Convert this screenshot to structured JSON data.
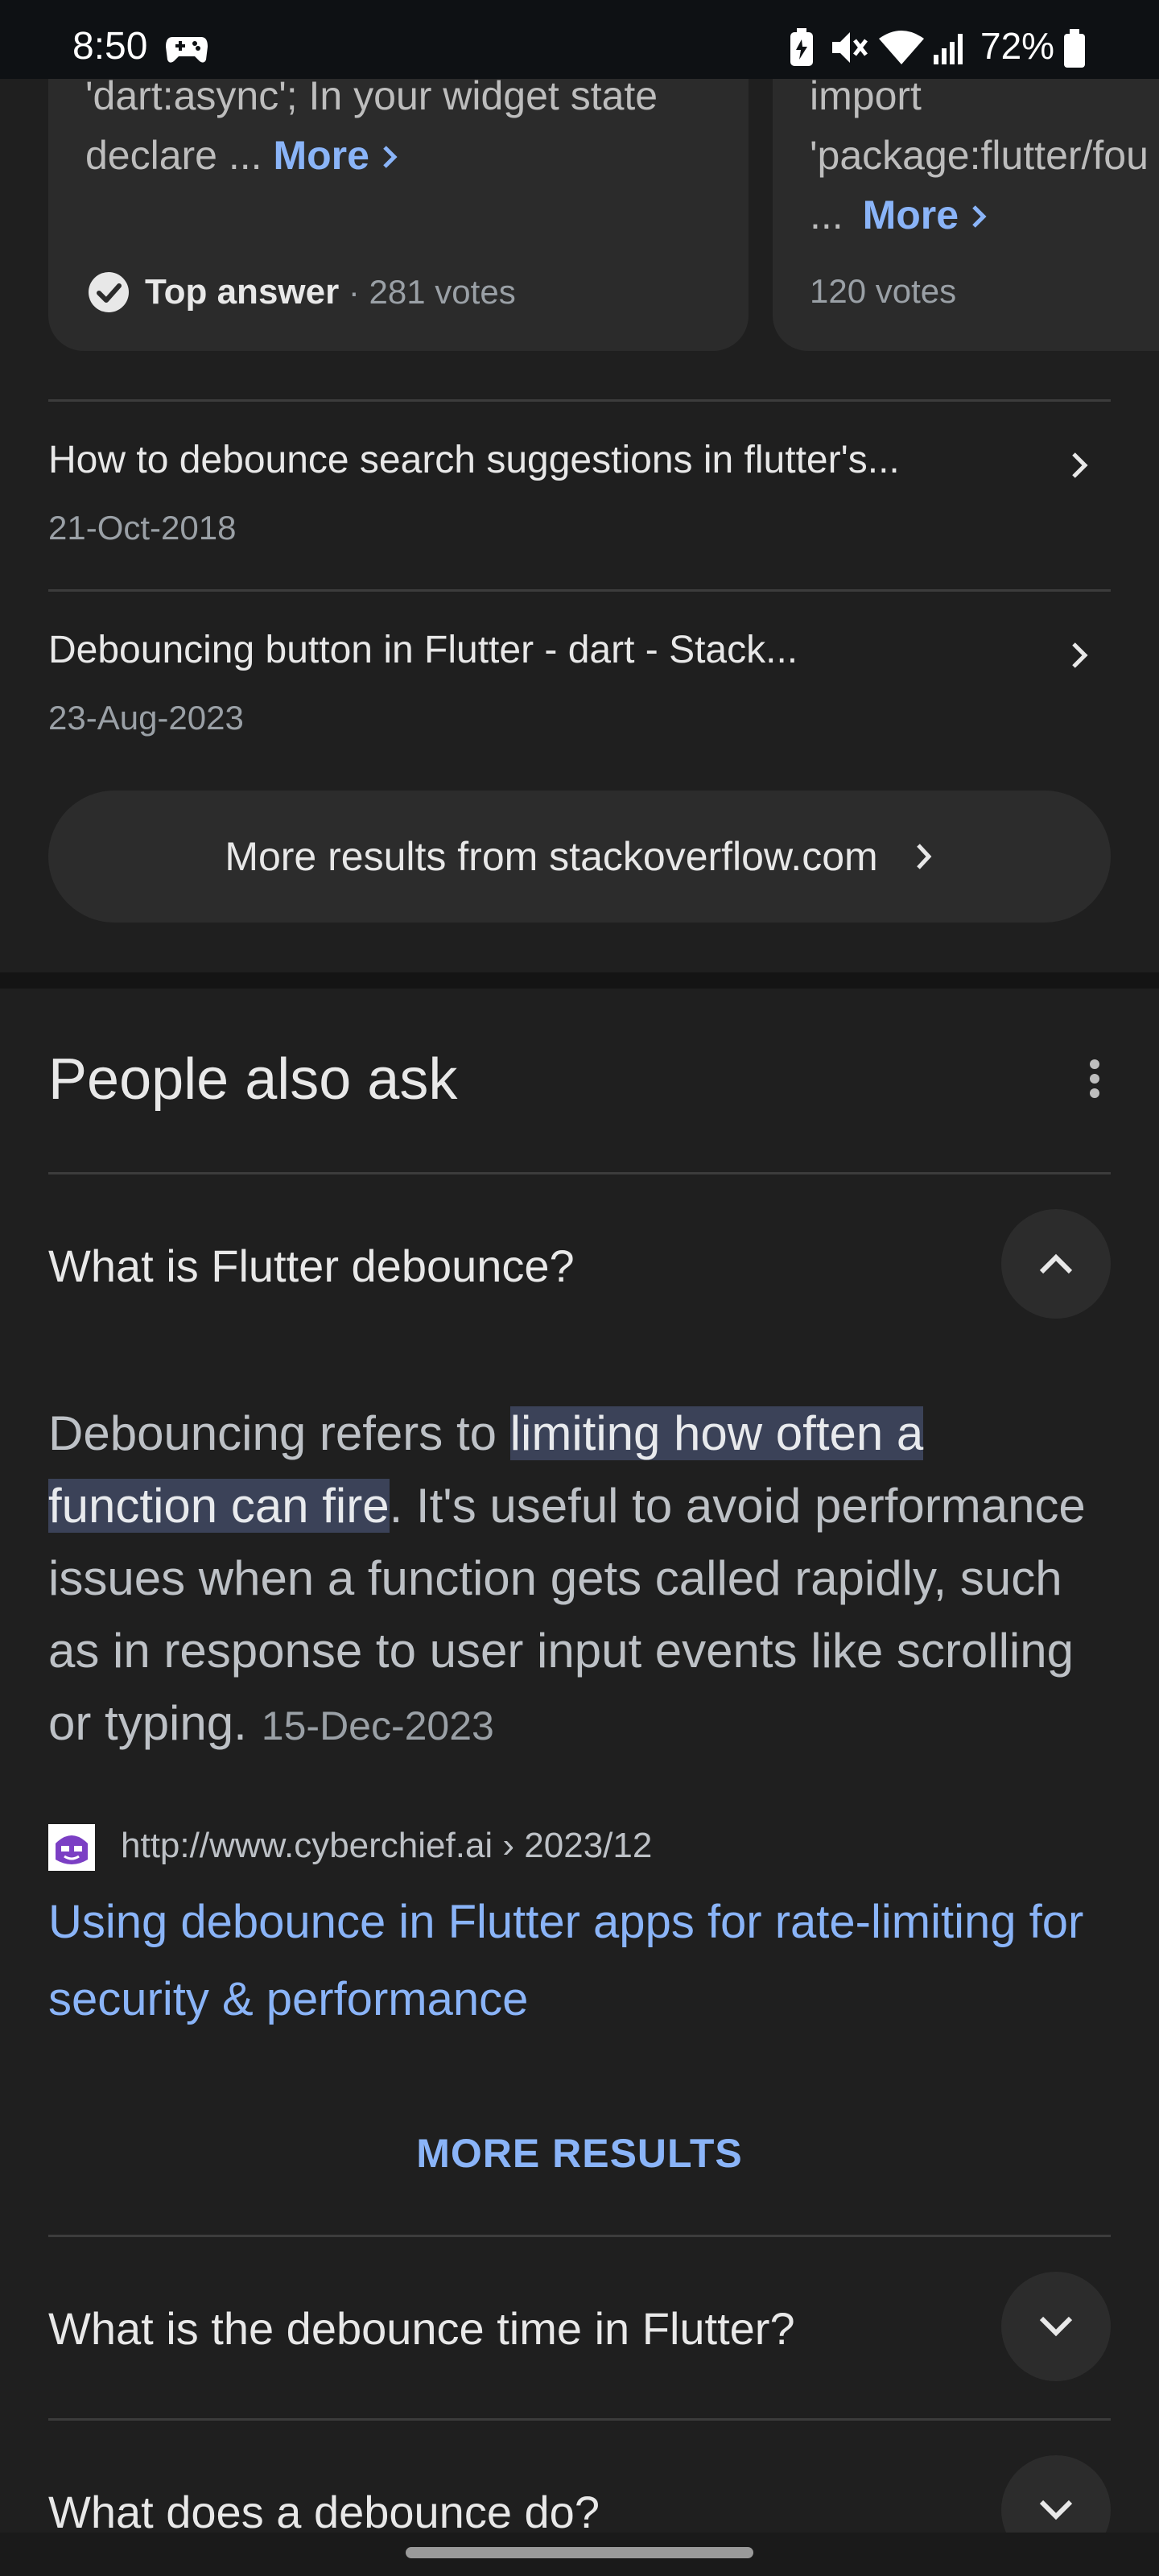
{
  "status_bar": {
    "time": "8:50",
    "battery": "72%",
    "icons": [
      "game-controller-icon",
      "battery-saver-icon",
      "mute-icon",
      "wifi-icon",
      "signal-icon",
      "battery-icon"
    ]
  },
  "cards": [
    {
      "line1": "'dart:async'; In your widget state",
      "line2": "declare ...",
      "more": "More",
      "badge": "Top answer",
      "votes": "· 281 votes"
    },
    {
      "line1": "import",
      "line2": "'package:flutter/fou",
      "line3": "...",
      "more": "More",
      "votes": "120 votes"
    }
  ],
  "results": [
    {
      "title": "How to debounce search suggestions in flutter's...",
      "date": "21-Oct-2018"
    },
    {
      "title": "Debouncing button in Flutter - dart - Stack...",
      "date": "23-Aug-2023"
    }
  ],
  "more_results_site": "More results from stackoverflow.com",
  "paa": {
    "title": "People also ask",
    "questions": [
      {
        "text": "What is Flutter debounce?",
        "expanded": true
      },
      {
        "text": "What is the debounce time in Flutter?",
        "expanded": false
      },
      {
        "text": "What does a debounce do?",
        "expanded": false
      }
    ],
    "answer": {
      "pre": "Debouncing refers to ",
      "highlight1": "limiting how often a",
      "highlight2": "function can fire",
      "post": ". It's useful to avoid performance issues when a function gets called rapidly, such as in response to user input events like scrolling or typing.",
      "date": "15-Dec-2023"
    },
    "source": {
      "url": "http://www.cyberchief.ai › 2023/12",
      "link": "Using debounce in Flutter apps for rate-limiting for security & performance"
    },
    "more_results": "MORE RESULTS"
  },
  "colors": {
    "background": "#1f1f1f",
    "link": "#8ab4f8",
    "highlight": "#3b4258",
    "card": "#2b2b2b"
  }
}
